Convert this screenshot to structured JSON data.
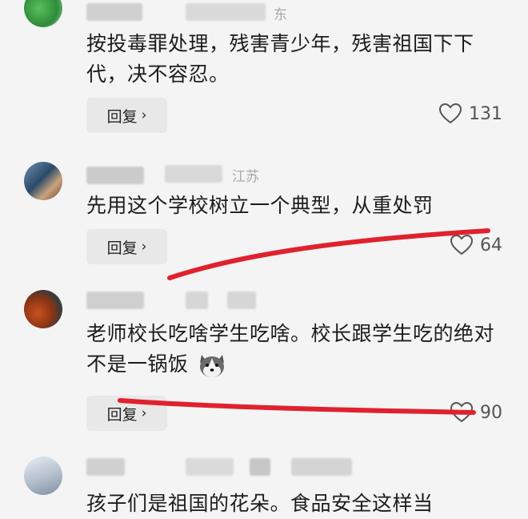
{
  "comments": [
    {
      "location": "东",
      "text": "按投毒罪处理，残害青少年，残害祖国下下代，决不容忍。",
      "reply_label": "回复",
      "likes": "131"
    },
    {
      "location": "江苏",
      "text": "先用这个学校树立一个典型，从重处罚",
      "reply_label": "回复",
      "likes": "64"
    },
    {
      "location": "",
      "text": "老师校长吃啥学生吃啥。校长跟学生吃的绝对不是一锅饭",
      "reply_label": "回复",
      "likes": "90"
    },
    {
      "location": "",
      "text": "孩子们是祖国的花朵。食品安全这样当",
      "reply_label": "",
      "likes": ""
    }
  ],
  "icons": {
    "like": "heart-outline-icon",
    "chevron": "chevron-right-icon",
    "emoji": "husky-emoji-icon"
  },
  "colors": {
    "annotation": "#e0212e",
    "reply_bg": "#e8e8e8"
  }
}
